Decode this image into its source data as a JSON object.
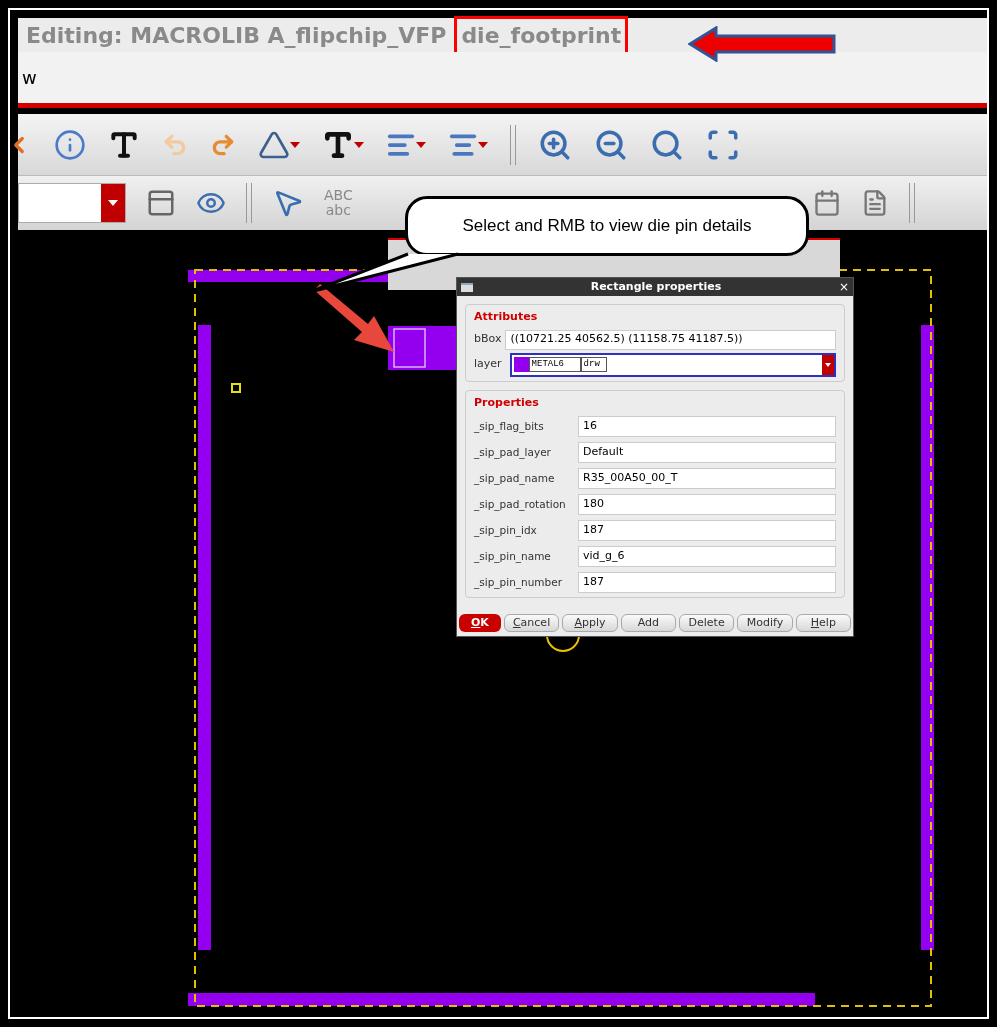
{
  "window": {
    "title_prefix": "Editing: MACROLIB A_flipchip_VFP",
    "title_highlight": "die_footprint"
  },
  "menu_bar": {
    "items": [
      "w"
    ]
  },
  "toolbar": {
    "text_icon": [
      "ABC",
      "abc"
    ]
  },
  "callout": "Select and RMB to view die pin details",
  "dialog": {
    "title": "Rectangle properties",
    "close": "×",
    "attributes_label": "Attributes",
    "bbox_label": "bBox",
    "bbox_value": "((10721.25 40562.5) (11158.75 41187.5))",
    "layer_label": "layer",
    "layer_name": "METAL6",
    "layer_purpose": "drw",
    "properties_label": "Properties",
    "properties": [
      {
        "name": "_sip_flag_bits",
        "value": "16"
      },
      {
        "name": "_sip_pad_layer",
        "value": "Default"
      },
      {
        "name": "_sip_pad_name",
        "value": "R35_00A50_00_T"
      },
      {
        "name": "_sip_pad_rotation",
        "value": "180"
      },
      {
        "name": "_sip_pin_idx",
        "value": "187"
      },
      {
        "name": "_sip_pin_name",
        "value": "vid_g_6"
      },
      {
        "name": "_sip_pin_number",
        "value": "187"
      }
    ],
    "buttons": [
      {
        "label": "OK",
        "primary": true,
        "underlined_initial": true
      },
      {
        "label": "Cancel",
        "primary": false,
        "underlined_initial": true
      },
      {
        "label": "Apply",
        "primary": false,
        "underlined_initial": true
      },
      {
        "label": "Add",
        "primary": false,
        "underlined_initial": false
      },
      {
        "label": "Delete",
        "primary": false,
        "underlined_initial": false
      },
      {
        "label": "Modify",
        "primary": false,
        "underlined_initial": false
      },
      {
        "label": "Help",
        "primary": false,
        "underlined_initial": true
      }
    ]
  }
}
